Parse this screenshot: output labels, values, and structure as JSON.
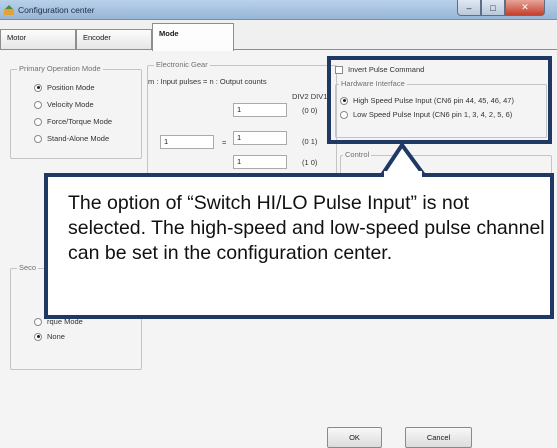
{
  "window": {
    "title": "Configuration center"
  },
  "tabs": [
    {
      "label": "Motor"
    },
    {
      "label": "Encoder"
    },
    {
      "label": "Mode"
    }
  ],
  "primary_mode": {
    "title": "Primary Operation Mode",
    "options": [
      {
        "label": "Position Mode",
        "selected": true
      },
      {
        "label": "Velocity Mode",
        "selected": false
      },
      {
        "label": "Force/Torque Mode",
        "selected": false
      },
      {
        "label": "Stand-Alone Mode",
        "selected": false
      }
    ]
  },
  "secondary_mode": {
    "title": "Seco",
    "partial_option": "rque Mode",
    "none_label": "None"
  },
  "electronic_gear": {
    "title": "Electronic Gear",
    "formula": "m : Input pulses  =  n : Output counts",
    "div_header": "DIV2 DIV1",
    "rows": [
      {
        "n": "1",
        "code": "(0 0)"
      },
      {
        "n": "1",
        "code": "(0 1)"
      },
      {
        "n": "1",
        "code": "(1 0)"
      }
    ],
    "m_value": "1",
    "equals": "="
  },
  "pulse": {
    "invert_label": "Invert Pulse Command",
    "hw_title": "Hardware Interface",
    "options": [
      {
        "label": "High Speed Pulse Input (CN6 pin 44, 45, 46, 47)",
        "selected": true
      },
      {
        "label": "Low Speed Pulse Input (CN6 pin 1, 3, 4, 2, 5, 6)",
        "selected": false
      }
    ]
  },
  "control_partial": "Control",
  "callout": {
    "text": "The option of “Switch HI/LO Pulse Input” is not selected. The high-speed and low-speed pulse channel can be set in the configuration center."
  },
  "buttons": {
    "ok": "OK",
    "cancel": "Cancel"
  },
  "colors": {
    "highlight": "#1f3864",
    "titlebar": "#b9d1ea",
    "close": "#c43f2a"
  }
}
